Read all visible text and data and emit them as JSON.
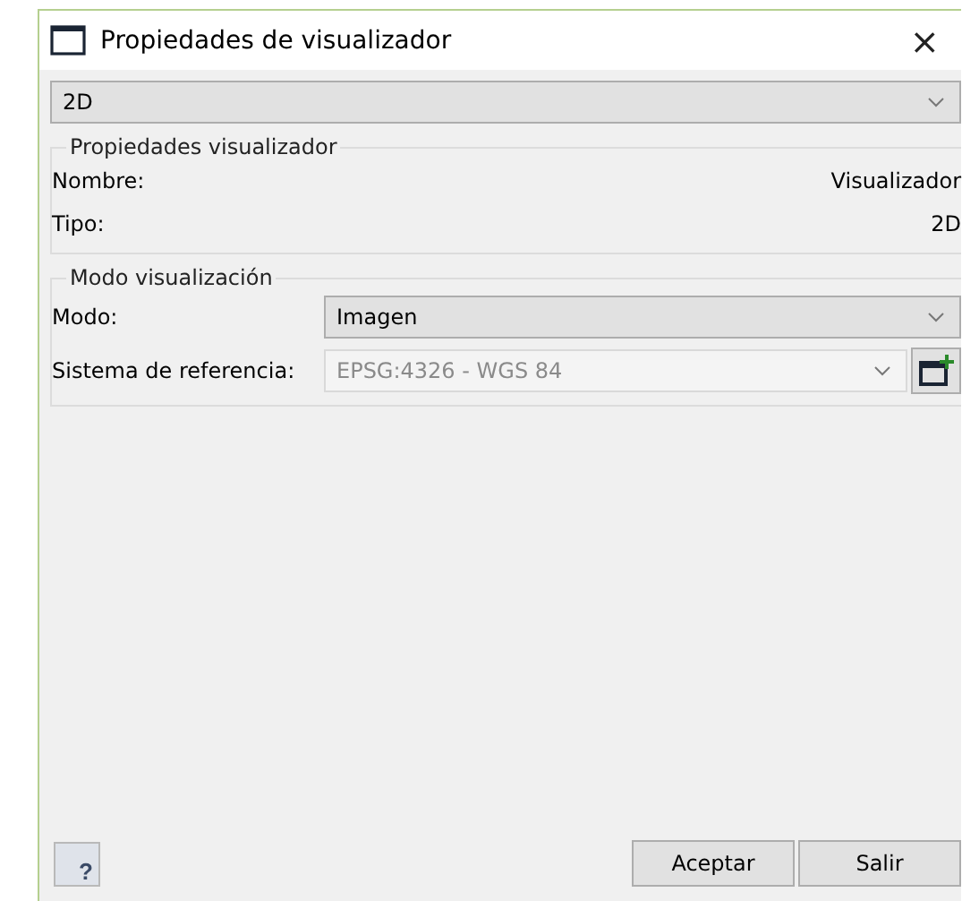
{
  "window": {
    "title": "Propiedades de visualizador",
    "close": "×"
  },
  "view_select": {
    "value": "2D"
  },
  "groups": [
    {
      "title": "Propiedades visualizador",
      "rows": [
        {
          "kind": "info",
          "label": "Nombre:",
          "value": "Visualizador"
        },
        {
          "kind": "info",
          "label": "Tipo:",
          "value": "2D"
        }
      ]
    },
    {
      "title": "Modo visualización",
      "rows": [
        {
          "kind": "select",
          "label": "Modo:",
          "value": "Imagen",
          "disabled": false
        },
        {
          "kind": "select_add",
          "label": "Sistema de referencia:",
          "value": "EPSG:4326 - WGS 84",
          "disabled": true
        }
      ]
    }
  ],
  "help_button": {
    "icon": "?"
  },
  "buttons": [
    "Aceptar",
    "Salir"
  ]
}
